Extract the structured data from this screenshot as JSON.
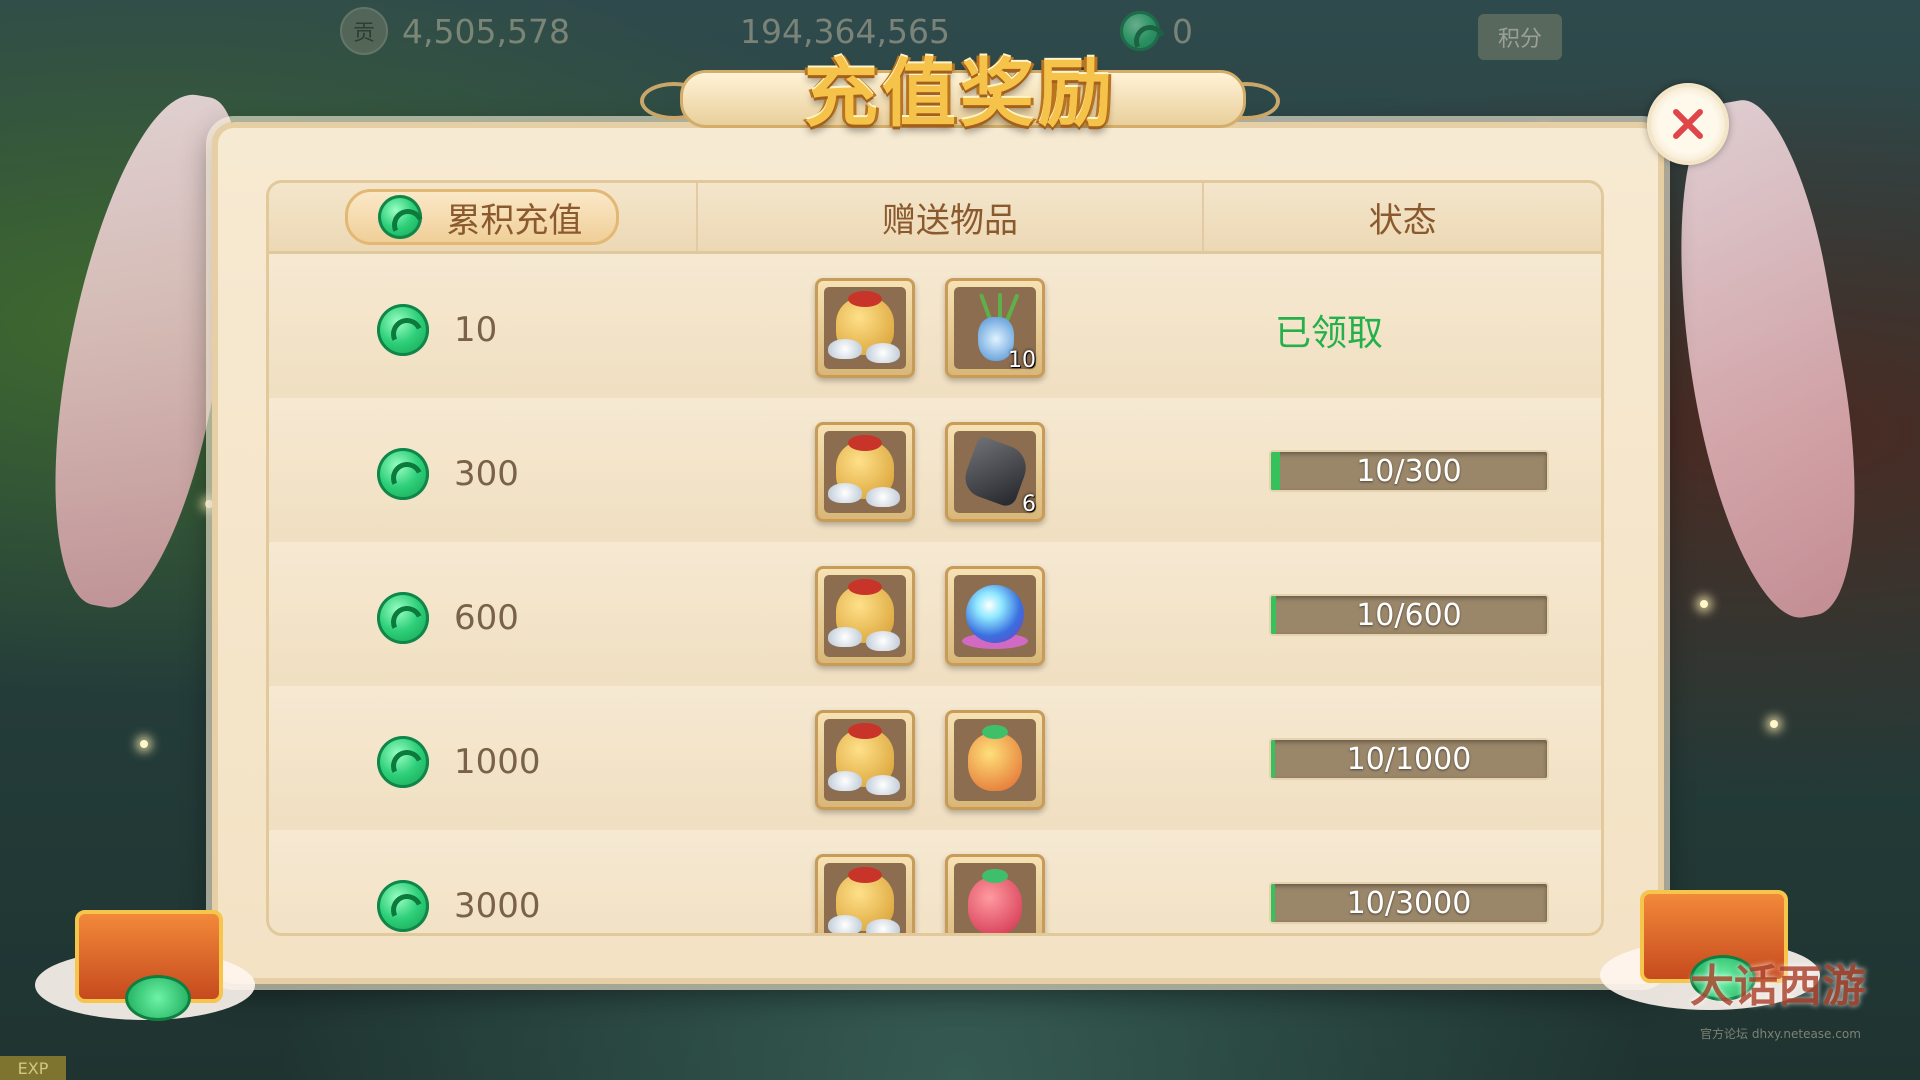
{
  "hud": {
    "contribution_icon": "贡",
    "contribution_value": "4,505,578",
    "silver_value": "194,364,565",
    "jade_value": "0",
    "score_label": "积分",
    "exp_label": "EXP"
  },
  "dialog": {
    "title": "充值奖励",
    "close_icon": "close-icon"
  },
  "table": {
    "headers": {
      "amount": "累积充值",
      "items": "赠送物品",
      "status": "状态"
    },
    "rows": [
      {
        "amount": "10",
        "item1": "silver-bag",
        "item2": "jade-vase",
        "item2_qty": "10",
        "status": "已领取",
        "claimed": true,
        "progress_text": "",
        "progress": 1.0
      },
      {
        "amount": "300",
        "item1": "silver-bag",
        "item2": "black-stone",
        "item2_qty": "6",
        "status": "",
        "claimed": false,
        "progress_text": "10/300",
        "progress": 0.033
      },
      {
        "amount": "600",
        "item1": "silver-bag",
        "item2": "crystal-orb",
        "item2_qty": "",
        "status": "",
        "claimed": false,
        "progress_text": "10/600",
        "progress": 0.017
      },
      {
        "amount": "1000",
        "item1": "silver-bag",
        "item2": "gold-gift-bag",
        "item2_qty": "",
        "status": "",
        "claimed": false,
        "progress_text": "10/1000",
        "progress": 0.01
      },
      {
        "amount": "3000",
        "item1": "silver-bag",
        "item2": "red-gift-bag",
        "item2_qty": "",
        "status": "",
        "claimed": false,
        "progress_text": "10/3000",
        "progress": 0.003
      }
    ]
  },
  "watermark": {
    "logo_text": "大话西游",
    "sub_text": "官方论坛",
    "url": "dhxy.netease.com"
  },
  "colors": {
    "claimed_green": "#25b04b",
    "bar_bg": "#9a8669",
    "bar_fill": "#37c15a",
    "panel": "#f3e2c4",
    "title_gold": "#f6c34a"
  }
}
